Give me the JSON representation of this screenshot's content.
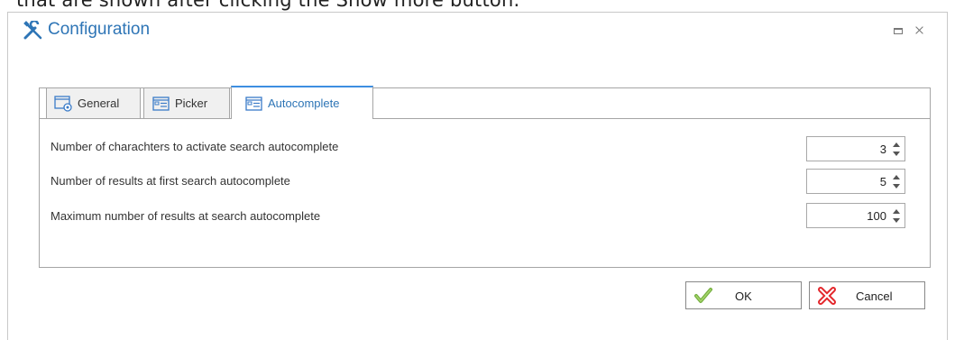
{
  "context_text": "that are shown after clicking the Show more button.",
  "dialog": {
    "title": "Configuration",
    "icon": "tools-icon",
    "window_buttons": [
      "maximize-icon",
      "close-icon"
    ]
  },
  "tabs": [
    {
      "label": "General",
      "icon": "window-settings-icon",
      "active": false
    },
    {
      "label": "Picker",
      "icon": "list-window-icon",
      "active": false
    },
    {
      "label": "Autocomplete",
      "icon": "list-window-icon",
      "active": true
    }
  ],
  "settings": [
    {
      "label": "Number of charachters to activate search autocomplete",
      "value": "3"
    },
    {
      "label": "Number of results at first search autocomplete",
      "value": "5"
    },
    {
      "label": "Maximum number of results at search autocomplete",
      "value": "100"
    }
  ],
  "buttons": {
    "ok": {
      "label": "OK",
      "icon": "checkmark-icon"
    },
    "cancel": {
      "label": "Cancel",
      "icon": "red-x-icon"
    }
  },
  "colors": {
    "accent": "#2e75b6",
    "active_tab_border": "#3d8ee1",
    "ok_icon": "#76b041",
    "cancel_icon": "#e3262b"
  }
}
